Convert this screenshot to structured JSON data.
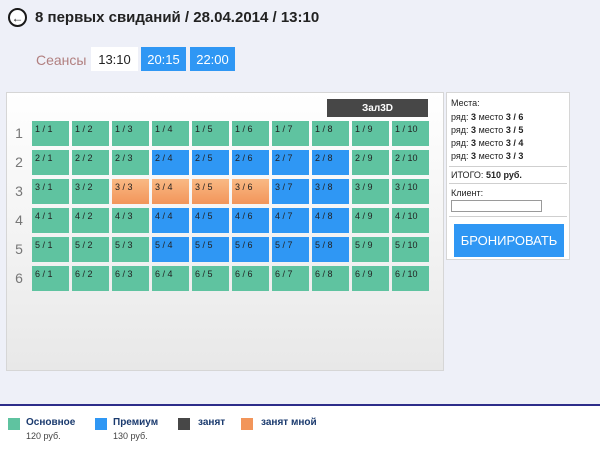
{
  "header": {
    "back_icon": "arrow-left-icon",
    "back_glyph": "←",
    "title": "8 первых свиданий / 28.04.2014 / 13:10"
  },
  "sessions": {
    "label": "Сеансы :",
    "items": [
      "13:10",
      "20:15",
      "22:00"
    ],
    "selected": "13:10"
  },
  "hall": {
    "name": "Зал3D",
    "rows": [
      {
        "label": "1",
        "seats": [
          {
            "label": "1 / 1",
            "type": "basic"
          },
          {
            "label": "1 / 2",
            "type": "basic"
          },
          {
            "label": "1 / 3",
            "type": "basic"
          },
          {
            "label": "1 / 4",
            "type": "basic"
          },
          {
            "label": "1 / 5",
            "type": "basic"
          },
          {
            "label": "1 / 6",
            "type": "basic"
          },
          {
            "label": "1 / 7",
            "type": "basic"
          },
          {
            "label": "1 / 8",
            "type": "basic"
          },
          {
            "label": "1 / 9",
            "type": "basic"
          },
          {
            "label": "1 / 10",
            "type": "basic"
          }
        ]
      },
      {
        "label": "2",
        "seats": [
          {
            "label": "2 / 1",
            "type": "basic"
          },
          {
            "label": "2 / 2",
            "type": "basic"
          },
          {
            "label": "2 / 3",
            "type": "basic"
          },
          {
            "label": "2 / 4",
            "type": "premium"
          },
          {
            "label": "2 / 5",
            "type": "premium"
          },
          {
            "label": "2 / 6",
            "type": "premium"
          },
          {
            "label": "2 / 7",
            "type": "premium"
          },
          {
            "label": "2 / 8",
            "type": "premium"
          },
          {
            "label": "2 / 9",
            "type": "basic"
          },
          {
            "label": "2 / 10",
            "type": "basic"
          }
        ]
      },
      {
        "label": "3",
        "seats": [
          {
            "label": "3 / 1",
            "type": "basic"
          },
          {
            "label": "3 / 2",
            "type": "basic"
          },
          {
            "label": "3 / 3",
            "type": "mine"
          },
          {
            "label": "3 / 4",
            "type": "mine"
          },
          {
            "label": "3 / 5",
            "type": "mine"
          },
          {
            "label": "3 / 6",
            "type": "mine"
          },
          {
            "label": "3 / 7",
            "type": "premium"
          },
          {
            "label": "3 / 8",
            "type": "premium"
          },
          {
            "label": "3 / 9",
            "type": "basic"
          },
          {
            "label": "3 / 10",
            "type": "basic"
          }
        ]
      },
      {
        "label": "4",
        "seats": [
          {
            "label": "4 / 1",
            "type": "basic"
          },
          {
            "label": "4 / 2",
            "type": "basic"
          },
          {
            "label": "4 / 3",
            "type": "basic"
          },
          {
            "label": "4 / 4",
            "type": "premium"
          },
          {
            "label": "4 / 5",
            "type": "premium"
          },
          {
            "label": "4 / 6",
            "type": "premium"
          },
          {
            "label": "4 / 7",
            "type": "premium"
          },
          {
            "label": "4 / 8",
            "type": "premium"
          },
          {
            "label": "4 / 9",
            "type": "basic"
          },
          {
            "label": "4 / 10",
            "type": "basic"
          }
        ]
      },
      {
        "label": "5",
        "seats": [
          {
            "label": "5 / 1",
            "type": "basic"
          },
          {
            "label": "5 / 2",
            "type": "basic"
          },
          {
            "label": "5 / 3",
            "type": "basic"
          },
          {
            "label": "5 / 4",
            "type": "premium"
          },
          {
            "label": "5 / 5",
            "type": "premium"
          },
          {
            "label": "5 / 6",
            "type": "premium"
          },
          {
            "label": "5 / 7",
            "type": "premium"
          },
          {
            "label": "5 / 8",
            "type": "premium"
          },
          {
            "label": "5 / 9",
            "type": "basic"
          },
          {
            "label": "5 / 10",
            "type": "basic"
          }
        ]
      },
      {
        "label": "6",
        "seats": [
          {
            "label": "6 / 1",
            "type": "basic"
          },
          {
            "label": "6 / 2",
            "type": "basic"
          },
          {
            "label": "6 / 3",
            "type": "basic"
          },
          {
            "label": "6 / 4",
            "type": "basic"
          },
          {
            "label": "6 / 5",
            "type": "basic"
          },
          {
            "label": "6 / 6",
            "type": "basic"
          },
          {
            "label": "6 / 7",
            "type": "basic"
          },
          {
            "label": "6 / 8",
            "type": "basic"
          },
          {
            "label": "6 / 9",
            "type": "basic"
          },
          {
            "label": "6 / 10",
            "type": "basic"
          }
        ]
      }
    ]
  },
  "order": {
    "places_label": "Места:",
    "places": [
      {
        "row_label": "ряд:",
        "row": "3",
        "place_label": "место",
        "seat": "3 / 6"
      },
      {
        "row_label": "ряд:",
        "row": "3",
        "place_label": "место",
        "seat": "3 / 5"
      },
      {
        "row_label": "ряд:",
        "row": "3",
        "place_label": "место",
        "seat": "3 / 4"
      },
      {
        "row_label": "ряд:",
        "row": "3",
        "place_label": "место",
        "seat": "3 / 3"
      }
    ],
    "total_label": "ИТОГО:",
    "total_value": "510 руб.",
    "client_label": "Клиент:",
    "client_value": "",
    "book_button": "БРОНИРОВАТЬ"
  },
  "legend": [
    {
      "name": "Основное",
      "price": "120 руб.",
      "color": "#5fc3a0"
    },
    {
      "name": "Премиум",
      "price": "130 руб.",
      "color": "#2f97f4"
    },
    {
      "name": "занят",
      "price": "",
      "color": "#474747"
    },
    {
      "name": "занят мной",
      "price": "",
      "color": "#f2955a"
    }
  ],
  "colors": {
    "basic": "#5fc3a0",
    "premium": "#2f97f4",
    "taken": "#474747",
    "mine": "#f2955a",
    "accent": "#2f97f4"
  }
}
